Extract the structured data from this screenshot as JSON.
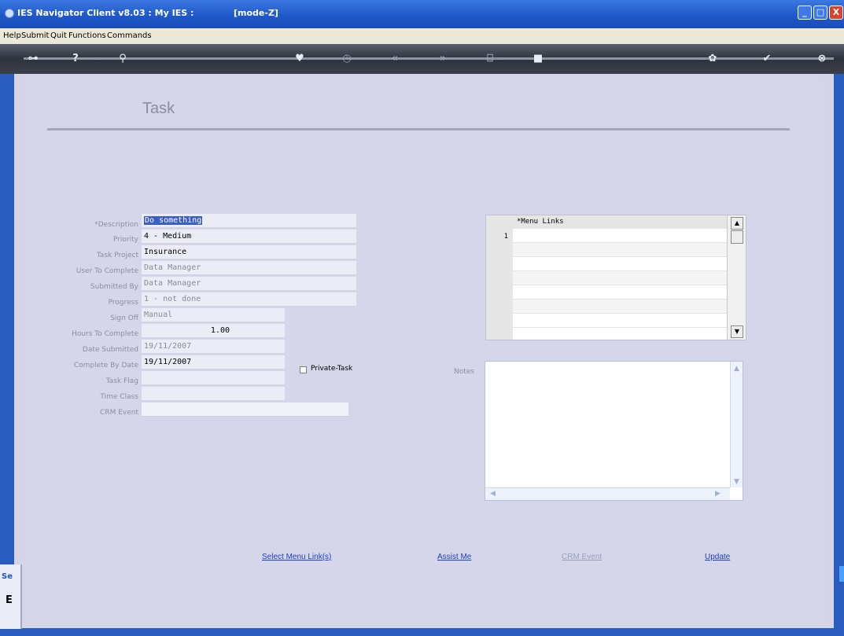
{
  "window": {
    "title": "IES Navigator Client v8.03 : My IES :",
    "mode": "[mode-Z]",
    "buttons": {
      "minimize": "_",
      "maximize": "□",
      "close": "X"
    }
  },
  "menu": [
    "Help",
    "Submit",
    "Quit",
    "Functions",
    "Commands"
  ],
  "toolbar": {
    "icons": [
      {
        "name": "key-icon",
        "glyph": "⊶"
      },
      {
        "name": "help-icon",
        "glyph": "?"
      },
      {
        "name": "search-icon",
        "glyph": "⚲"
      },
      {
        "name": "heart-icon",
        "glyph": "♥"
      },
      {
        "name": "clock-icon",
        "glyph": "◷"
      },
      {
        "name": "back-icon",
        "glyph": "«"
      },
      {
        "name": "forward-icon",
        "glyph": "»"
      },
      {
        "name": "tree-icon",
        "glyph": "⌸"
      },
      {
        "name": "stop-icon",
        "glyph": "■"
      },
      {
        "name": "settings-icon",
        "glyph": "✿"
      },
      {
        "name": "ok-icon",
        "glyph": "✔"
      },
      {
        "name": "close-icon",
        "glyph": "⊗"
      }
    ]
  },
  "page": {
    "title": "Task"
  },
  "form": {
    "description": {
      "label": "*Description",
      "value": "Do something"
    },
    "priority": {
      "label": "Priority",
      "value": "4 - Medium"
    },
    "task_project": {
      "label": "Task Project",
      "value": "Insurance"
    },
    "user_to_complete": {
      "label": "User To Complete",
      "value": "Data Manager"
    },
    "submitted_by": {
      "label": "Submitted By",
      "value": "Data Manager"
    },
    "progress": {
      "label": "Progress",
      "value": "1 - not done"
    },
    "sign_off": {
      "label": "Sign Off",
      "value": "Manual"
    },
    "hours_to_complete": {
      "label": "Hours To Complete",
      "value": "1.00"
    },
    "date_submitted": {
      "label": "Date Submitted",
      "value": "19/11/2007"
    },
    "complete_by_date": {
      "label": "Complete By Date",
      "value": "19/11/2007"
    },
    "task_flag": {
      "label": "Task Flag",
      "value": ""
    },
    "time_class": {
      "label": "Time Class",
      "value": ""
    },
    "crm_event": {
      "label": "CRM Event",
      "value": ""
    },
    "private_task": {
      "label": "Private-Task",
      "checked": false
    }
  },
  "menu_links": {
    "header": "*Menu Links",
    "rows": [
      {
        "num": "1",
        "value": ""
      }
    ]
  },
  "notes": {
    "label": "Notes",
    "value": ""
  },
  "actions": {
    "select_menu_links": "Select Menu Link(s)",
    "assist_me": "Assist Me",
    "crm_event": "CRM Event",
    "update": "Update"
  },
  "side_tab": {
    "label": "Se",
    "glyph": "E"
  },
  "colors": {
    "accent": "#1d56c8",
    "link": "#1a3fbf",
    "background": "#d5d4e8",
    "highlight": "#3a5ec8"
  }
}
